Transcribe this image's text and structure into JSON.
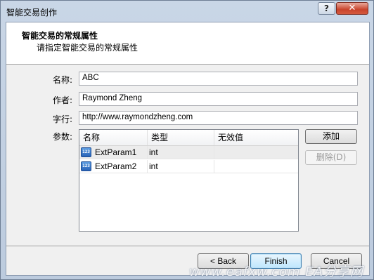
{
  "window": {
    "title": "智能交易创作",
    "help_glyph": "?",
    "close_glyph": "✕"
  },
  "header": {
    "title": "智能交易的常规属性",
    "subtitle": "请指定智能交易的常规属性"
  },
  "form": {
    "name_label": "名称:",
    "name_value": "ABC",
    "author_label": "作者:",
    "author_value": "Raymond Zheng",
    "link_label": "字行:",
    "link_value": "http://www.raymondzheng.com",
    "params_label": "参数:"
  },
  "params_table": {
    "columns": [
      "名称",
      "类型",
      "无效值"
    ],
    "rows": [
      {
        "icon": "param-icon",
        "icon_text": "123",
        "name": "ExtParam1",
        "type": "int",
        "default": ""
      },
      {
        "icon": "param-icon",
        "icon_text": "123",
        "name": "ExtParam2",
        "type": "int",
        "default": ""
      }
    ]
  },
  "buttons": {
    "add": "添加",
    "delete": "删除(D)",
    "back": "< Back",
    "finish": "Finish",
    "cancel": "Cancel"
  },
  "watermark": "www.eafxw.com  EA分享网"
}
